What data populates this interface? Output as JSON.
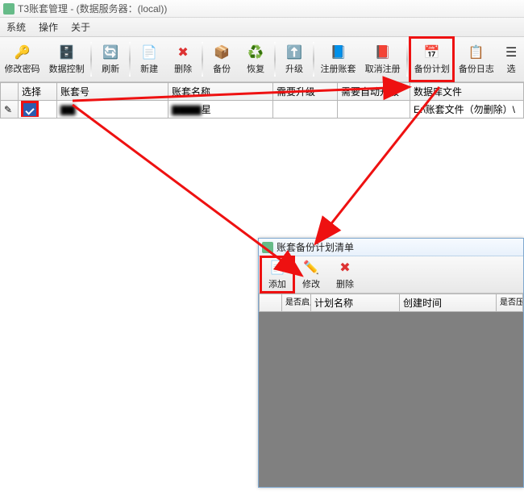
{
  "main": {
    "title": "T3账套管理 - (数据服务器：(local))",
    "menus": {
      "system": "系统",
      "ops": "操作",
      "about": "关于"
    },
    "toolbar": {
      "changepwd": "修改密码",
      "datactrl": "数据控制",
      "refresh": "刷新",
      "new": "新建",
      "del": "删除",
      "backup": "备份",
      "restore": "恢复",
      "upgrade": "升级",
      "reg": "注册账套",
      "unreg": "取消注册",
      "plan": "备份计划",
      "log": "备份日志",
      "more": "选"
    },
    "cols": {
      "sel": "选择",
      "no": "账套号",
      "name": "账套名称",
      "need": "需要升级",
      "auto": "需要自动升级",
      "file": "数据库文件"
    },
    "row1": {
      "sel": true,
      "name_blurred": "星",
      "file": "E:\\账套文件（勿删除）\\"
    }
  },
  "child": {
    "title": "账套备份计划清单",
    "toolbar": {
      "add": "添加",
      "edit": "修改",
      "del": "删除"
    },
    "cols": {
      "enable": "是否启用",
      "plan": "计划名称",
      "ctime": "创建时间",
      "compress": "是否压缩备"
    }
  }
}
